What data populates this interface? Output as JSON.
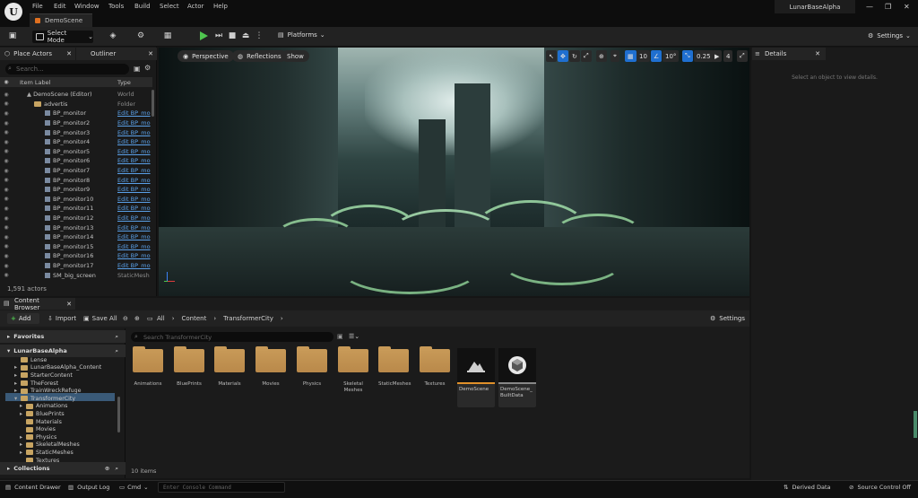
{
  "menu": [
    "File",
    "Edit",
    "Window",
    "Tools",
    "Build",
    "Select",
    "Actor",
    "Help"
  ],
  "scene_tab": "DemoScene",
  "project_name": "LunarBaseAlpha",
  "toolbar": {
    "select_mode": "Select Mode",
    "platforms": "Platforms",
    "settings": "Settings"
  },
  "left_tabs": {
    "place_actors": "Place Actors",
    "outliner": "Outliner"
  },
  "outliner": {
    "search_placeholder": "Search...",
    "col_label": "Item Label",
    "col_type": "Type",
    "rows": [
      {
        "label": "DemoScene (Editor)",
        "type": "World",
        "link": false,
        "indent": 1,
        "kind": "world"
      },
      {
        "label": "advertis",
        "type": "Folder",
        "link": false,
        "indent": 2,
        "kind": "folder"
      },
      {
        "label": "BP_monitor",
        "type": "Edit BP_mo",
        "link": true,
        "indent": 3,
        "kind": "bp"
      },
      {
        "label": "BP_monitor2",
        "type": "Edit BP_mo",
        "link": true,
        "indent": 3,
        "kind": "bp"
      },
      {
        "label": "BP_monitor3",
        "type": "Edit BP_mo",
        "link": true,
        "indent": 3,
        "kind": "bp"
      },
      {
        "label": "BP_monitor4",
        "type": "Edit BP_mo",
        "link": true,
        "indent": 3,
        "kind": "bp"
      },
      {
        "label": "BP_monitor5",
        "type": "Edit BP_mo",
        "link": true,
        "indent": 3,
        "kind": "bp"
      },
      {
        "label": "BP_monitor6",
        "type": "Edit BP_mo",
        "link": true,
        "indent": 3,
        "kind": "bp"
      },
      {
        "label": "BP_monitor7",
        "type": "Edit BP_mo",
        "link": true,
        "indent": 3,
        "kind": "bp"
      },
      {
        "label": "BP_monitor8",
        "type": "Edit BP_mo",
        "link": true,
        "indent": 3,
        "kind": "bp"
      },
      {
        "label": "BP_monitor9",
        "type": "Edit BP_mo",
        "link": true,
        "indent": 3,
        "kind": "bp"
      },
      {
        "label": "BP_monitor10",
        "type": "Edit BP_mo",
        "link": true,
        "indent": 3,
        "kind": "bp"
      },
      {
        "label": "BP_monitor11",
        "type": "Edit BP_mo",
        "link": true,
        "indent": 3,
        "kind": "bp"
      },
      {
        "label": "BP_monitor12",
        "type": "Edit BP_mo",
        "link": true,
        "indent": 3,
        "kind": "bp"
      },
      {
        "label": "BP_monitor13",
        "type": "Edit BP_mo",
        "link": true,
        "indent": 3,
        "kind": "bp"
      },
      {
        "label": "BP_monitor14",
        "type": "Edit BP_mo",
        "link": true,
        "indent": 3,
        "kind": "bp"
      },
      {
        "label": "BP_monitor15",
        "type": "Edit BP_mo",
        "link": true,
        "indent": 3,
        "kind": "bp"
      },
      {
        "label": "BP_monitor16",
        "type": "Edit BP_mo",
        "link": true,
        "indent": 3,
        "kind": "bp"
      },
      {
        "label": "BP_monitor17",
        "type": "Edit BP_mo",
        "link": true,
        "indent": 3,
        "kind": "bp"
      },
      {
        "label": "SM_big_screen",
        "type": "StaticMesh",
        "link": false,
        "indent": 3,
        "kind": "mesh"
      }
    ],
    "actor_count": "1,591 actors"
  },
  "viewport": {
    "perspective": "Perspective",
    "reflections": "Reflections",
    "show": "Show",
    "grid_snap": "10",
    "rot_snap": "10°",
    "scale_snap": "0.25",
    "cam_speed": "4"
  },
  "details": {
    "tab": "Details",
    "empty_msg": "Select an object to view details."
  },
  "content_browser": {
    "tab": "Content Browser",
    "add": "Add",
    "import": "Import",
    "save_all": "Save All",
    "breadcrumb": [
      "All",
      "Content",
      "TransformerCity"
    ],
    "settings": "Settings",
    "favorites": "Favorites",
    "root": "LunarBaseAlpha",
    "collections": "Collections",
    "search_placeholder": "Search TransformerCity",
    "tree": [
      {
        "label": "Lense",
        "indent": 1,
        "expander": ""
      },
      {
        "label": "LunarBaseAlpha_Content",
        "indent": 1,
        "expander": "▸"
      },
      {
        "label": "StarterContent",
        "indent": 1,
        "expander": "▸"
      },
      {
        "label": "TheForest",
        "indent": 1,
        "expander": "▸"
      },
      {
        "label": "TrainWreckRefuge",
        "indent": 1,
        "expander": "▸"
      },
      {
        "label": "TransformerCity",
        "indent": 1,
        "expander": "▾"
      },
      {
        "label": "Animations",
        "indent": 2,
        "expander": "▸"
      },
      {
        "label": "BluePrints",
        "indent": 2,
        "expander": "▸"
      },
      {
        "label": "Materials",
        "indent": 2,
        "expander": ""
      },
      {
        "label": "Movies",
        "indent": 2,
        "expander": ""
      },
      {
        "label": "Physics",
        "indent": 2,
        "expander": "▸"
      },
      {
        "label": "SkeletalMeshes",
        "indent": 2,
        "expander": "▸"
      },
      {
        "label": "StaticMeshes",
        "indent": 2,
        "expander": "▸"
      },
      {
        "label": "Textures",
        "indent": 2,
        "expander": ""
      }
    ],
    "folders": [
      "Animations",
      "BluePrints",
      "Materials",
      "Movies",
      "Physics",
      "Skeletal Meshes",
      "StaticMeshes",
      "Textures"
    ],
    "assets": [
      {
        "name": "DemoScene",
        "icon": "level-icon"
      },
      {
        "name": "DemoScene_ BuiltData",
        "icon": "builtdata-icon"
      }
    ],
    "item_count": "10 items"
  },
  "statusbar": {
    "content_drawer": "Content Drawer",
    "output_log": "Output Log",
    "cmd": "Cmd",
    "console_placeholder": "Enter Console Command",
    "derived_data": "Derived Data",
    "source_control": "Source Control Off"
  }
}
